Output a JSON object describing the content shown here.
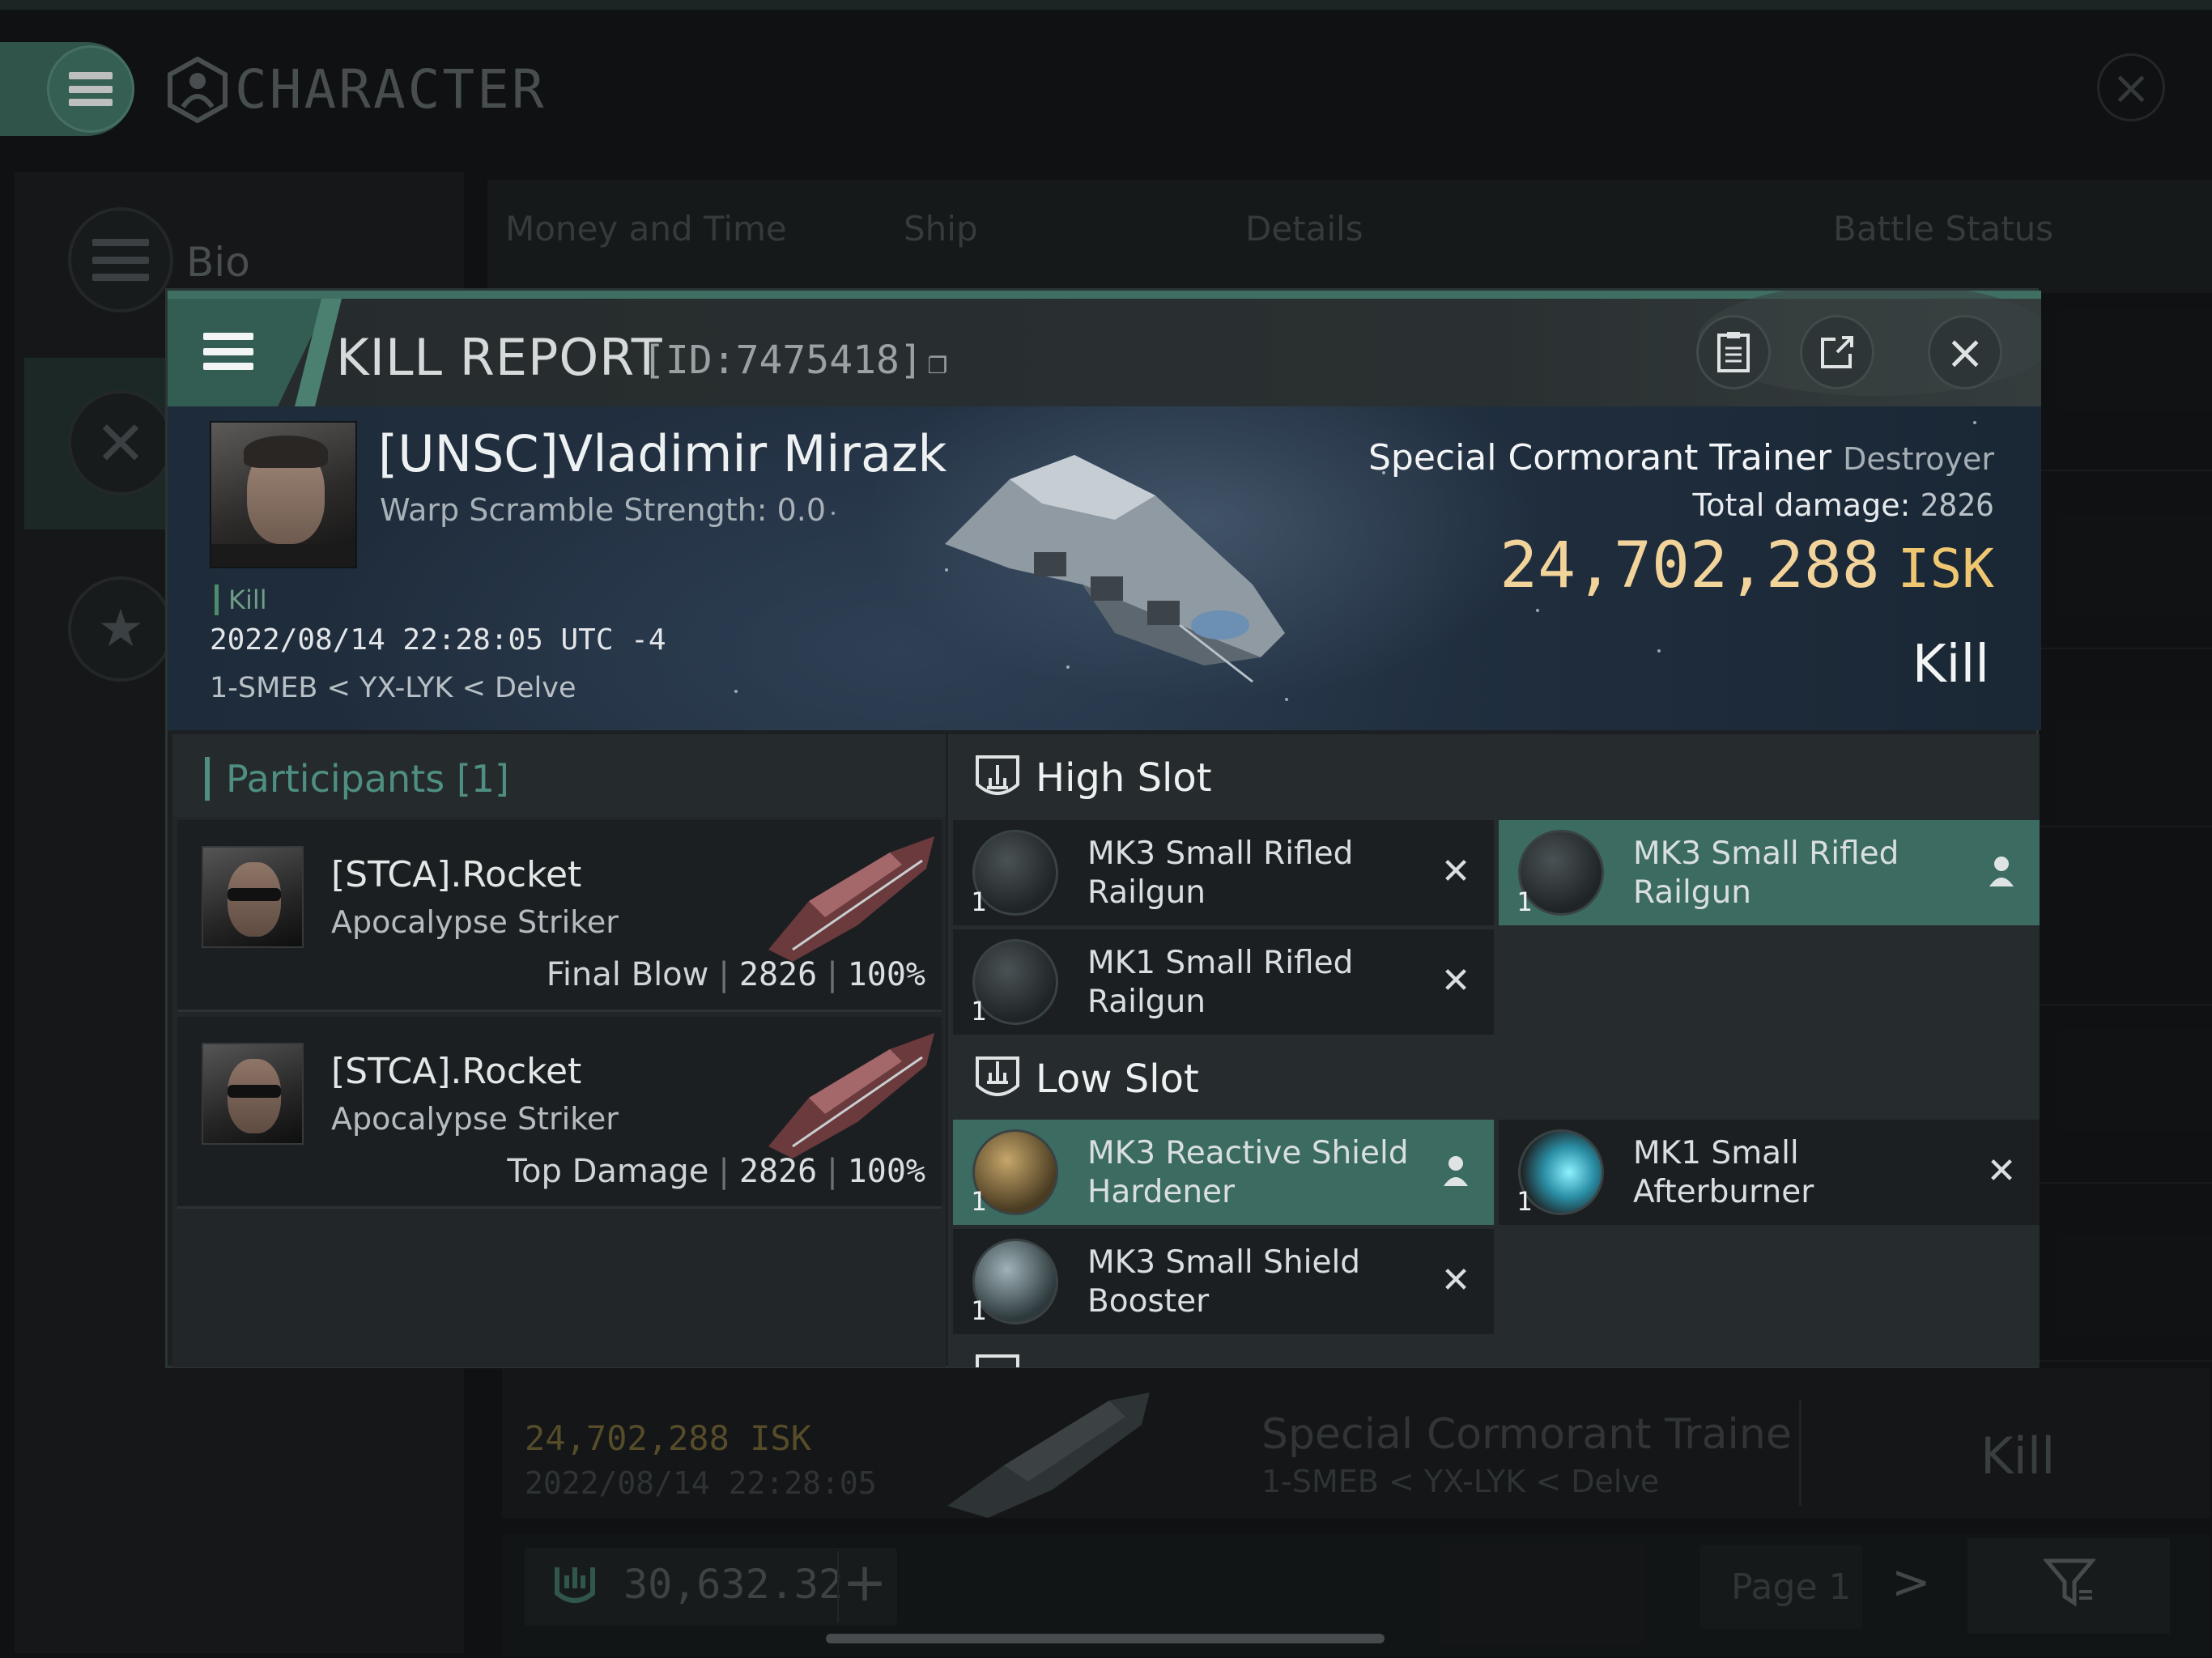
{
  "screen": {
    "title": "CHARACTER",
    "sidebar": [
      {
        "label": "Bio"
      }
    ],
    "tabs": [
      "Money and Time",
      "Ship",
      "Details",
      "Battle Status"
    ],
    "bg_entry": {
      "isk": "24,702,288",
      "isk_unit": "ISK",
      "date": "2022/08/14  22:28:05",
      "ship": "Special Cormorant Traine",
      "location": "1-SMEB < YX-LYK < Delve",
      "result": "Kill"
    },
    "wallet": {
      "value": "30,632.32",
      "add": "+"
    },
    "pager": {
      "label": "Page 1",
      "next": ">"
    }
  },
  "modal": {
    "title": "KILL REPORT",
    "id": "[ID:7475418]",
    "victim": {
      "name": "[UNSC]Vladimir Mirazk",
      "warp": "Warp Scramble Strength: 0.0",
      "tag": "Kill",
      "datetime": "2022/08/14 22:28:05 UTC -4",
      "location": "1-SMEB < YX-LYK < Delve",
      "ship": "Special Cormorant Trainer",
      "ship_class": "Destroyer",
      "damage_label": "Total damage:",
      "damage": "2826",
      "isk": "24,702,288",
      "isk_unit": "ISK",
      "result": "Kill"
    },
    "participants": {
      "label": "Participants",
      "count": "[1]",
      "rows": [
        {
          "name": "[STCA].Rocket",
          "ship": "Apocalypse Striker",
          "role": "Final Blow",
          "damage": "2826",
          "percent": "100%"
        },
        {
          "name": "[STCA].Rocket",
          "ship": "Apocalypse Striker",
          "role": "Top Damage",
          "damage": "2826",
          "percent": "100%"
        }
      ]
    },
    "slots": {
      "high": {
        "title": "High Slot",
        "modules": [
          {
            "name": "MK3 Small Rifled Railgun",
            "qty": "1",
            "status": "destroyed"
          },
          {
            "name": "MK3 Small Rifled Railgun",
            "qty": "1",
            "status": "dropped"
          },
          {
            "name": "MK1 Small Rifled Railgun",
            "qty": "1",
            "status": "destroyed"
          }
        ]
      },
      "low": {
        "title": "Low Slot",
        "modules": [
          {
            "name": "MK3 Reactive Shield Hardener",
            "qty": "1",
            "status": "dropped"
          },
          {
            "name": "MK1 Small Afterburner",
            "qty": "1",
            "status": "destroyed"
          },
          {
            "name": "MK3 Small Shield Booster",
            "qty": "1",
            "status": "destroyed"
          }
        ]
      }
    }
  }
}
